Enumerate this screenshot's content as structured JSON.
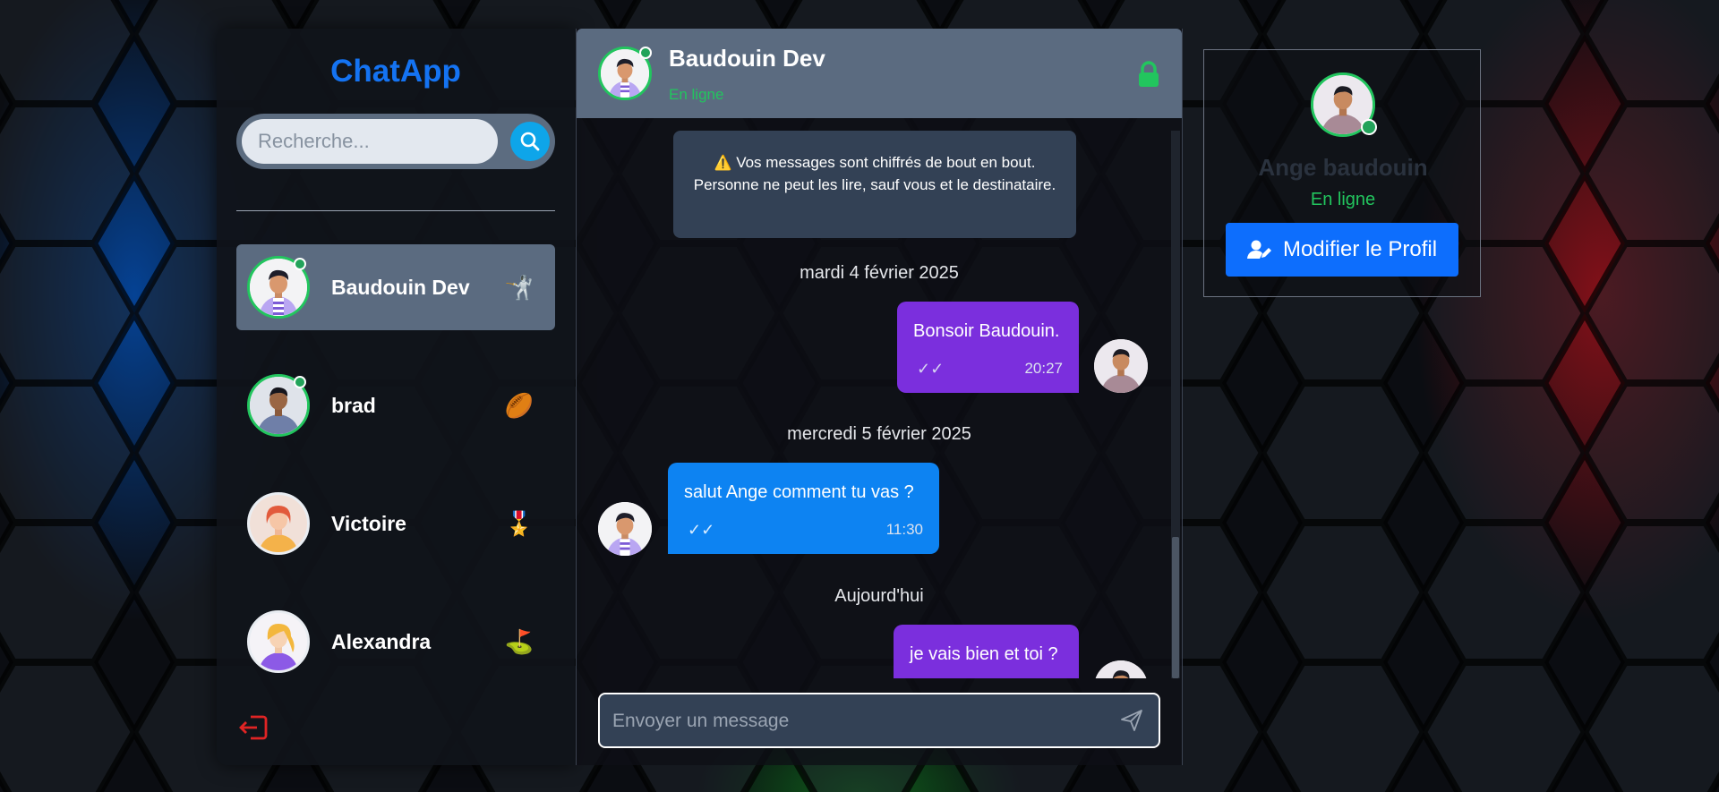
{
  "sidebar": {
    "brand": "ChatApp",
    "search": {
      "placeholder": "Recherche...",
      "value": "",
      "icon": "search-icon"
    },
    "contacts": [
      {
        "name": "Baudouin Dev",
        "online": true,
        "active": true,
        "emoji": "🤺"
      },
      {
        "name": "brad",
        "online": true,
        "active": false,
        "emoji": "🏉"
      },
      {
        "name": "Victoire",
        "online": false,
        "active": false,
        "emoji": "🎖️"
      },
      {
        "name": "Alexandra",
        "online": false,
        "active": false,
        "emoji": "⛳"
      }
    ],
    "logout_icon": "logout-icon"
  },
  "chat": {
    "header": {
      "name": "Baudouin Dev",
      "status": "En ligne",
      "lock_icon": "lock-icon"
    },
    "notice": {
      "icon": "⚠️",
      "text": "Vos messages sont chiffrés de bout en bout. Personne ne peut les lire, sauf vous et le destinataire."
    },
    "dates": [
      "mardi 4 février 2025",
      "mercredi 5 février 2025",
      "Aujourd'hui"
    ],
    "messages": [
      {
        "text": "Bonsoir Baudouin.",
        "time": "20:27",
        "checks": "✓✓",
        "direction": "sent"
      },
      {
        "text": "salut Ange comment tu vas ?",
        "time": "11:30",
        "checks": "✓✓",
        "direction": "received"
      },
      {
        "text": "je vais bien et toi ?",
        "time": "",
        "checks": "",
        "direction": "sent"
      }
    ],
    "composer": {
      "placeholder": "Envoyer un message",
      "value": "",
      "send_icon": "send-icon"
    }
  },
  "profile": {
    "name": "Ange baudouin",
    "status": "En ligne",
    "edit_button": "Modifier le Profil",
    "edit_icon": "user-edit-icon"
  },
  "colors": {
    "brand": "#1473f2",
    "online": "#22c55e",
    "sent_bubble": "#7b2fdd",
    "received_bubble": "#0d83f2",
    "header_bg": "#5b6b80",
    "primary_button": "#0d6efd"
  }
}
